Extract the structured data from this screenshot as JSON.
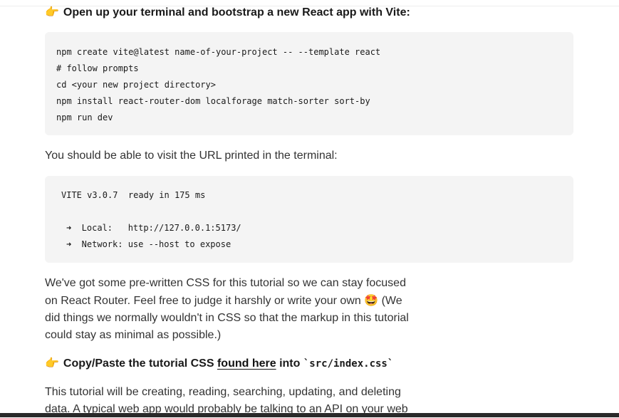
{
  "step1": {
    "icon": "pointing-hand-emoji",
    "hand": "👉",
    "text": "Open up your terminal and bootstrap a new React app with Vite:"
  },
  "code1": {
    "lines": [
      "npm create vite@latest name-of-your-project -- --template react",
      "# follow prompts",
      "cd <your new project directory>",
      "npm install react-router-dom localforage match-sorter sort-by",
      "npm run dev"
    ]
  },
  "para1": "You should be able to visit the URL printed in the terminal:",
  "code2": {
    "lines": [
      "VITE v3.0.7  ready in 175 ms",
      "➜  Local:   http://127.0.0.1:5173/",
      "➜  Network: use --host to expose"
    ]
  },
  "para2": {
    "lines": [
      "We've got some pre-written CSS for this tutorial so we can stay focused",
      "on React Router. Feel free to judge it harshly or write your own",
      "did things we normally wouldn't in CSS so that the markup in this tutorial",
      "could stay as minimal as possible.)"
    ],
    "emoji": "🤩",
    "after_emoji": " (We"
  },
  "step2": {
    "hand": "👉",
    "prefix": "Copy/Paste the tutorial CSS ",
    "link": "found here",
    "middle": " into ",
    "code": "`src/index.css`"
  },
  "para3": {
    "lines": [
      "This tutorial will be creating, reading, searching, updating, and deleting",
      "data. A typical web app would probably be talking to an API on your web"
    ]
  }
}
